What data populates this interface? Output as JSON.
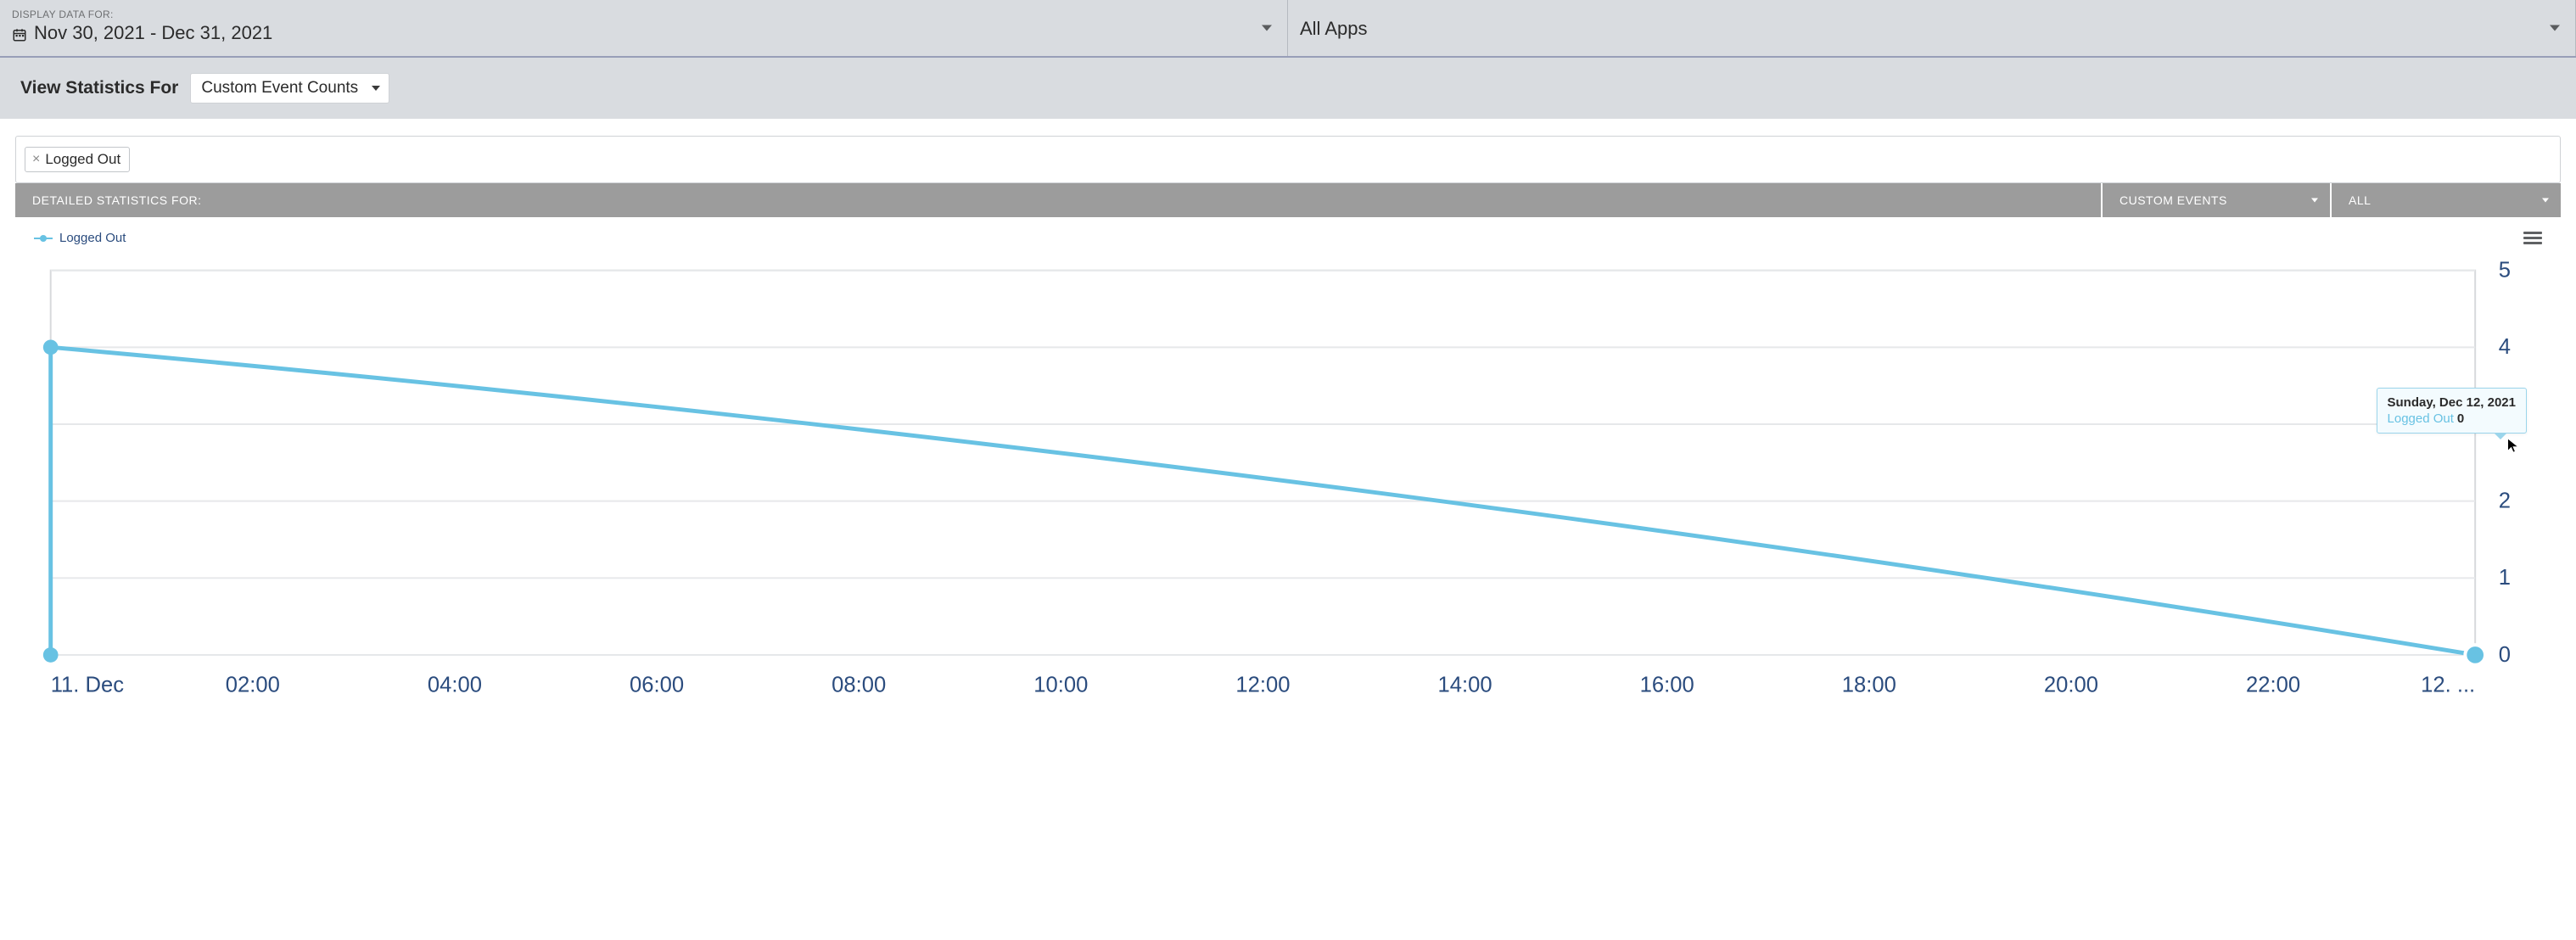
{
  "header": {
    "display_label": "DISPLAY DATA FOR:",
    "date_range": "Nov 30, 2021 - Dec 31, 2021",
    "apps_selector": "All Apps"
  },
  "secondary": {
    "view_label": "View Statistics For",
    "statistic_selected": "Custom Event Counts"
  },
  "filters": {
    "chips": [
      "Logged Out"
    ]
  },
  "strip": {
    "label": "DETAILED STATISTICS FOR:",
    "select1": "CUSTOM EVENTS",
    "select2": "ALL"
  },
  "legend": {
    "series_name": "Logged Out"
  },
  "tooltip": {
    "date": "Sunday, Dec 12, 2021",
    "series": "Logged Out",
    "value": "0"
  },
  "chart_data": {
    "type": "line",
    "title": "",
    "xlabel": "",
    "ylabel": "",
    "ylim": [
      0,
      5
    ],
    "y_ticks": [
      0,
      1,
      2,
      3,
      4,
      5
    ],
    "x_ticks": [
      "11. Dec",
      "02:00",
      "04:00",
      "06:00",
      "08:00",
      "10:00",
      "12:00",
      "14:00",
      "16:00",
      "18:00",
      "20:00",
      "22:00",
      "12. ..."
    ],
    "series": [
      {
        "name": "Logged Out",
        "color": "#68C2E3",
        "points": [
          {
            "x_index": 0,
            "x_label": "11. Dec 00:00",
            "y": 0
          },
          {
            "x_index": 0,
            "x_label": "11. Dec 00:00",
            "y": 4
          },
          {
            "x_index": 12,
            "x_label": "12. Dec 00:00",
            "y": 0
          }
        ]
      }
    ]
  }
}
